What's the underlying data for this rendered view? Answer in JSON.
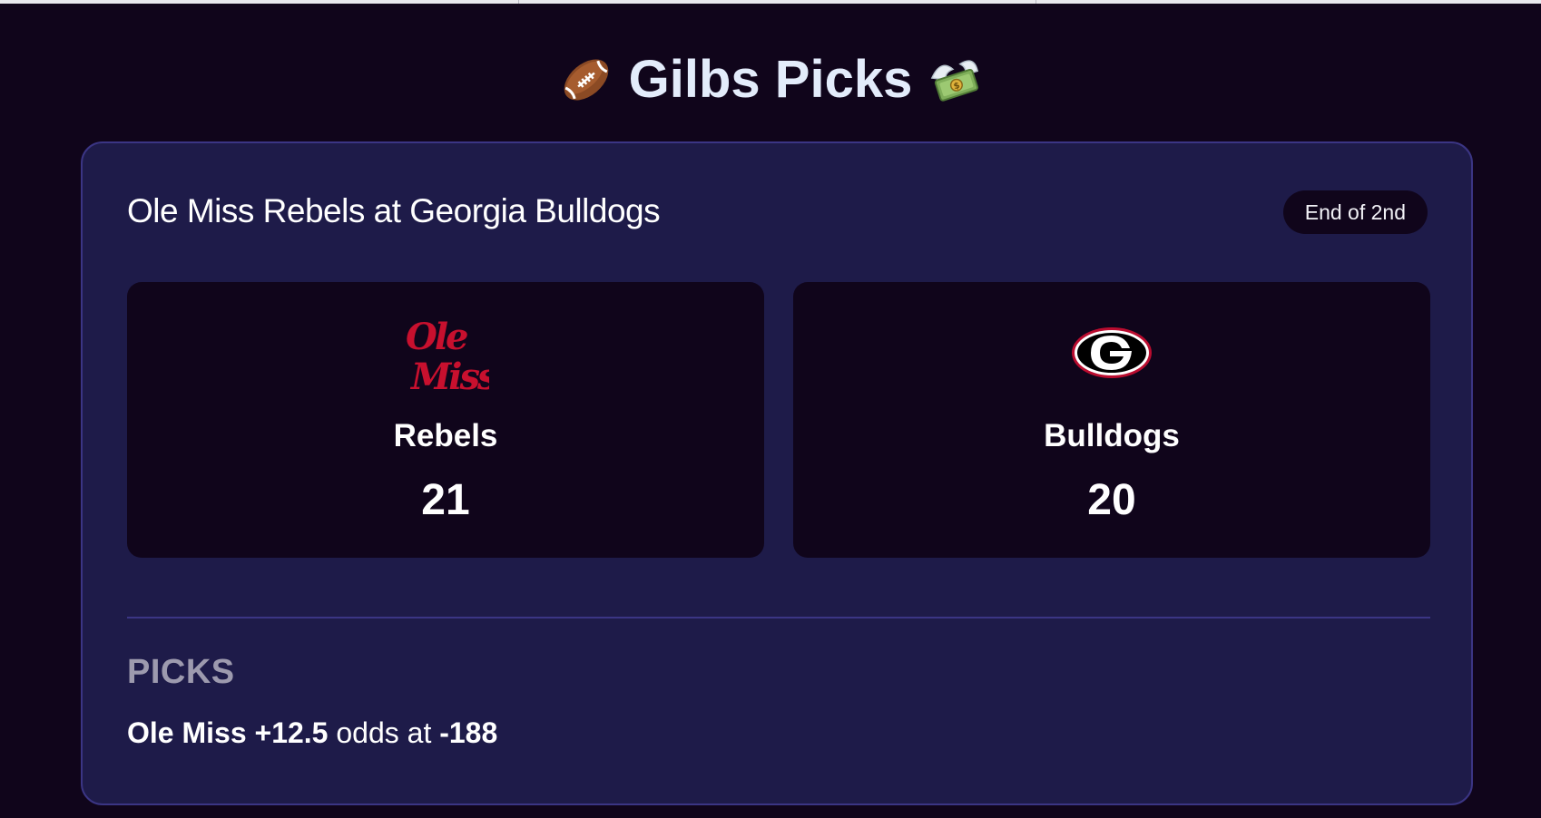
{
  "app": {
    "title": "Gilbs Picks",
    "title_icons": [
      "football-icon",
      "money-with-wings-icon"
    ]
  },
  "game": {
    "heading": "Ole Miss Rebels at Georgia Bulldogs",
    "status": "End of 2nd",
    "away": {
      "name": "Rebels",
      "score": "21",
      "logo_icon": "ole-miss-logo-icon",
      "logo_color": "#c8102e"
    },
    "home": {
      "name": "Bulldogs",
      "score": "20",
      "logo_icon": "georgia-g-logo-icon",
      "logo_color": "#000000",
      "logo_outline": "#ba0c2f"
    }
  },
  "picks": {
    "heading": "PICKS",
    "items": [
      {
        "selection": "Ole Miss +12.5",
        "connector": "odds at",
        "odds": "-188"
      }
    ]
  },
  "colors": {
    "page_background": "#10051b",
    "card_background": "#1e1b49",
    "card_border": "#3b3584",
    "title_text": "#e3ecfb",
    "muted_text": "#9d9aae"
  }
}
